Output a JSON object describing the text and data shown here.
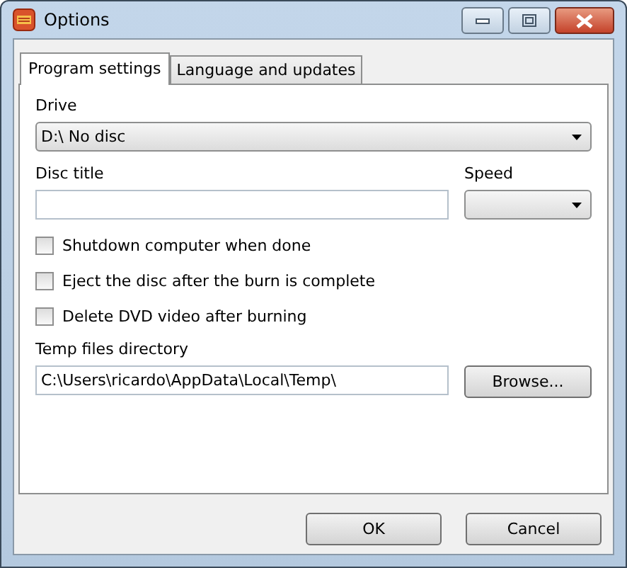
{
  "window": {
    "title": "Options"
  },
  "tabs": [
    {
      "label": "Program settings",
      "selected": true
    },
    {
      "label": "Language and updates",
      "selected": false
    }
  ],
  "drive": {
    "label": "Drive",
    "value": "D:\\ No disc"
  },
  "disc_title": {
    "label": "Disc title"
  },
  "speed": {
    "label": "Speed"
  },
  "options": [
    {
      "label": "Shutdown computer when done",
      "checked": false
    },
    {
      "label": "Eject the disc after the burn is complete",
      "checked": false
    },
    {
      "label": "Delete DVD video after burning",
      "checked": false
    }
  ],
  "temp_dir": {
    "label": "Temp files directory",
    "value": "C:\\Users\\ricardo\\AppData\\Local\\Temp\\",
    "button": "Browse..."
  },
  "buttons": [
    "OK",
    "Cancel"
  ]
}
